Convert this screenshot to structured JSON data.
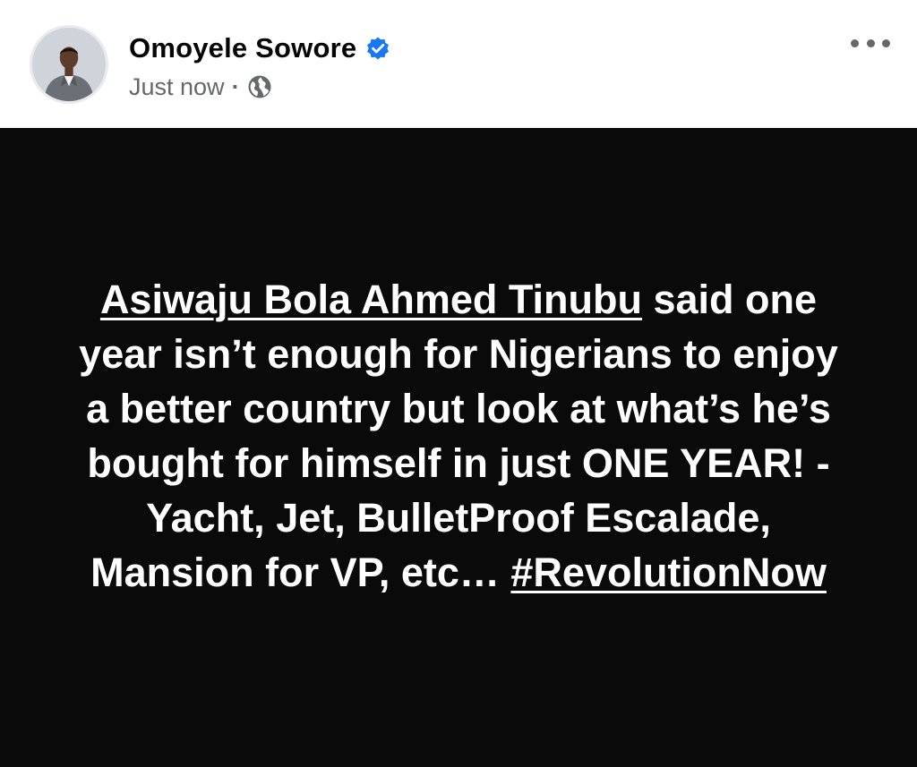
{
  "post": {
    "author": {
      "name": "Omoyele Sowore",
      "verified": true,
      "avatar_icon": "profile-photo"
    },
    "meta": {
      "timestamp": "Just now",
      "separator": "·",
      "audience_icon": "globe-icon"
    },
    "menu_icon": "more-options-icon",
    "body": {
      "background_color": "#0a0a0a",
      "text_color": "#ffffff",
      "mention": "Asiwaju Bola Ahmed Tinubu",
      "text_part1": " said one year isn’t enough for Nigerians to enjoy a better country but look at what’s he’s bought for himself in just ONE YEAR! -Yacht, Jet, BulletProof Escalade, Mansion for VP, etc… ",
      "hashtag": "#RevolutionNow"
    }
  },
  "colors": {
    "verified_badge": "#1877f2",
    "meta_text": "#65676b",
    "name_text": "#050505"
  }
}
